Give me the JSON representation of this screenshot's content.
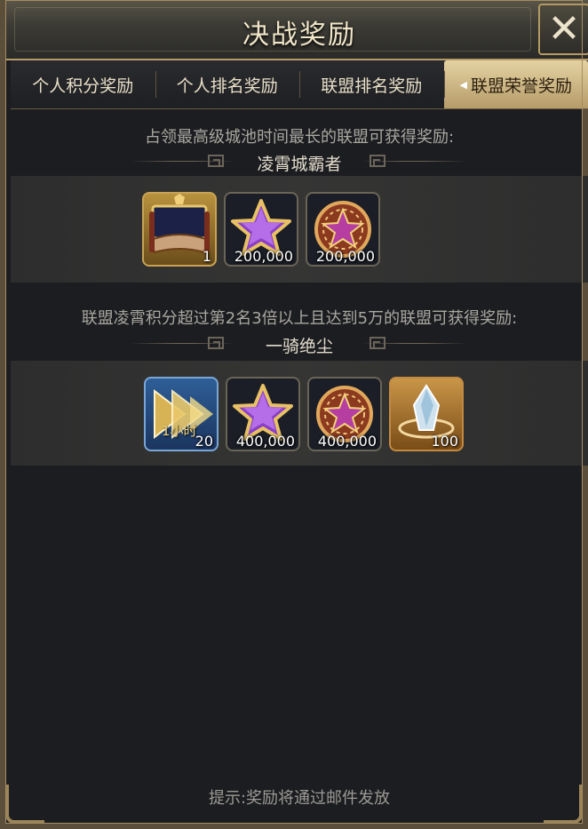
{
  "window": {
    "title": "决战奖励"
  },
  "close_button": {
    "icon": "close-icon"
  },
  "tabs": [
    {
      "label": "个人积分奖励",
      "active": false
    },
    {
      "label": "个人排名奖励",
      "active": false
    },
    {
      "label": "联盟排名奖励",
      "active": false
    },
    {
      "label": "联盟荣誉奖励",
      "active": true
    }
  ],
  "sections": [
    {
      "description": "占领最高级城池时间最长的联盟可获得奖励:",
      "title": "凌霄城霸者",
      "rewards": [
        {
          "icon": "scroll-chest-icon",
          "quantity": "1"
        },
        {
          "icon": "purple-star-icon",
          "quantity": "200,000"
        },
        {
          "icon": "star-medal-icon",
          "quantity": "200,000"
        }
      ]
    },
    {
      "description": "联盟凌霄积分超过第2名3倍以上且达到5万的联盟可获得奖励:",
      "title": "一骑绝尘",
      "rewards": [
        {
          "icon": "speedup-icon",
          "quantity": "20",
          "tag": "1小时"
        },
        {
          "icon": "purple-star-icon",
          "quantity": "400,000"
        },
        {
          "icon": "star-medal-icon",
          "quantity": "400,000"
        },
        {
          "icon": "crystal-icon",
          "quantity": "100"
        }
      ]
    }
  ],
  "footer": {
    "hint": "提示:奖励将通过邮件发放"
  },
  "colors": {
    "accent_gold": "#b59b66",
    "active_tab": "#e4d2a2",
    "background": "#1c1d21"
  }
}
